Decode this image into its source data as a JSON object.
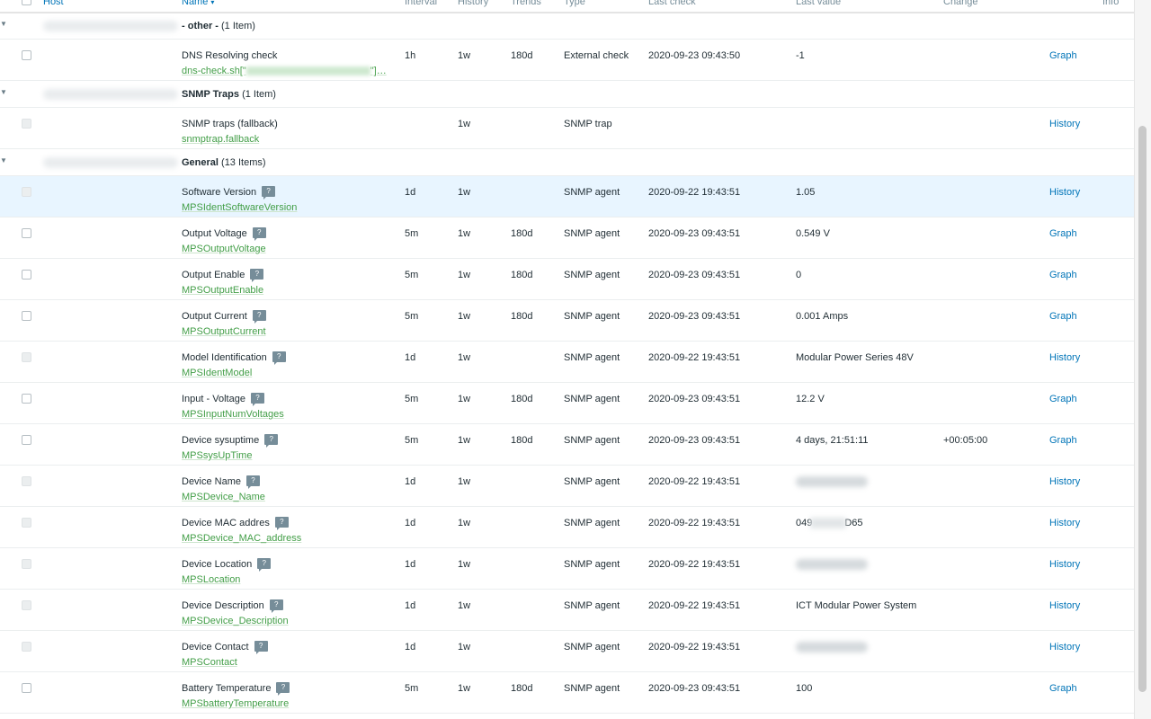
{
  "header": {
    "host": "Host",
    "name": "Name",
    "name_sort": "▾",
    "interval": "Interval",
    "history": "History",
    "trends": "Trends",
    "type": "Type",
    "last_check": "Last check",
    "last_value": "Last value",
    "change": "Change",
    "info": "Info"
  },
  "groups": [
    {
      "name": "- other -",
      "count": "(1 Item)",
      "items": [
        {
          "name": "DNS Resolving check",
          "key": "dns-check.sh[\"",
          "key_suffix": "\"]…",
          "interval": "1h",
          "history": "1w",
          "trends": "180d",
          "type": "External check",
          "last_check": "2020-09-23 09:43:50",
          "last_value": "-1",
          "change": "",
          "action": "Graph"
        }
      ]
    },
    {
      "name": "SNMP Traps",
      "count": "(1 Item)",
      "items": [
        {
          "name": "SNMP traps (fallback)",
          "key": "snmptrap.fallback",
          "interval": "",
          "history": "1w",
          "trends": "",
          "type": "SNMP trap",
          "last_check": "",
          "last_value": "",
          "change": "",
          "action": "History"
        }
      ]
    },
    {
      "name": "General",
      "count": "(13 Items)",
      "items": [
        {
          "name": "Software Version",
          "key": "MPSIdentSoftwareVersion",
          "interval": "1d",
          "history": "1w",
          "trends": "",
          "type": "SNMP agent",
          "last_check": "2020-09-22 19:43:51",
          "last_value": "1.05",
          "change": "",
          "action": "History"
        },
        {
          "name": "Output Voltage",
          "key": "MPSOutputVoltage",
          "interval": "5m",
          "history": "1w",
          "trends": "180d",
          "type": "SNMP agent",
          "last_check": "2020-09-23 09:43:51",
          "last_value": "0.549 V",
          "change": "",
          "action": "Graph"
        },
        {
          "name": "Output Enable",
          "key": "MPSOutputEnable",
          "interval": "5m",
          "history": "1w",
          "trends": "180d",
          "type": "SNMP agent",
          "last_check": "2020-09-23 09:43:51",
          "last_value": "0",
          "change": "",
          "action": "Graph"
        },
        {
          "name": "Output Current",
          "key": "MPSOutputCurrent",
          "interval": "5m",
          "history": "1w",
          "trends": "180d",
          "type": "SNMP agent",
          "last_check": "2020-09-23 09:43:51",
          "last_value": "0.001 Amps",
          "change": "",
          "action": "Graph"
        },
        {
          "name": "Model Identification",
          "key": "MPSIdentModel",
          "interval": "1d",
          "history": "1w",
          "trends": "",
          "type": "SNMP agent",
          "last_check": "2020-09-22 19:43:51",
          "last_value": "Modular Power Series 48V",
          "change": "",
          "action": "History"
        },
        {
          "name": "Input - Voltage",
          "key": "MPSInputNumVoltages",
          "interval": "5m",
          "history": "1w",
          "trends": "180d",
          "type": "SNMP agent",
          "last_check": "2020-09-23 09:43:51",
          "last_value": "12.2 V",
          "change": "",
          "action": "Graph"
        },
        {
          "name": "Device sysuptime",
          "key": "MPSsysUpTime",
          "interval": "5m",
          "history": "1w",
          "trends": "180d",
          "type": "SNMP agent",
          "last_check": "2020-09-23 09:43:51",
          "last_value": "4 days, 21:51:11",
          "change": "+00:05:00",
          "action": "Graph"
        },
        {
          "name": "Device Name",
          "key": "MPSDevice_Name",
          "interval": "1d",
          "history": "1w",
          "trends": "",
          "type": "SNMP agent",
          "last_check": "2020-09-22 19:43:51",
          "last_value": "",
          "change": "",
          "action": "History"
        },
        {
          "name": "Device MAC addres",
          "key": "MPSDevice_MAC_address",
          "interval": "1d",
          "history": "1w",
          "trends": "",
          "type": "SNMP agent",
          "last_check": "2020-09-22 19:43:51",
          "last_value": "049",
          "last_value_suffix": "D65",
          "change": "",
          "action": "History"
        },
        {
          "name": "Device Location",
          "key": "MPSLocation",
          "interval": "1d",
          "history": "1w",
          "trends": "",
          "type": "SNMP agent",
          "last_check": "2020-09-22 19:43:51",
          "last_value": "",
          "change": "",
          "action": "History"
        },
        {
          "name": "Device Description",
          "key": "MPSDevice_Description",
          "interval": "1d",
          "history": "1w",
          "trends": "",
          "type": "SNMP agent",
          "last_check": "2020-09-22 19:43:51",
          "last_value": "ICT Modular Power System",
          "change": "",
          "action": "History"
        },
        {
          "name": "Device Contact",
          "key": "MPSContact",
          "interval": "1d",
          "history": "1w",
          "trends": "",
          "type": "SNMP agent",
          "last_check": "2020-09-22 19:43:51",
          "last_value": "",
          "change": "",
          "action": "History"
        },
        {
          "name": "Battery Temperature",
          "key": "MPSbatteryTemperature",
          "interval": "5m",
          "history": "1w",
          "trends": "180d",
          "type": "SNMP agent",
          "last_check": "2020-09-23 09:43:51",
          "last_value": "100",
          "change": "",
          "action": "Graph"
        }
      ]
    }
  ]
}
